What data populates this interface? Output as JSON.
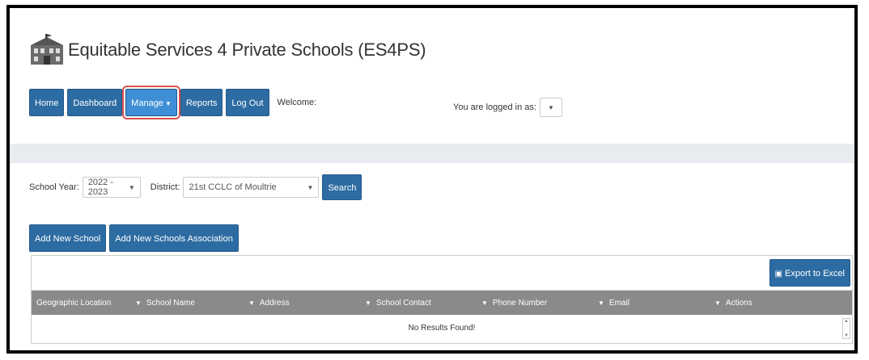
{
  "app": {
    "title": "Equitable Services 4 Private Schools (ES4PS)"
  },
  "nav": {
    "items": [
      "Home",
      "Dashboard",
      "Manage",
      "Reports",
      "Log Out"
    ],
    "welcome": "Welcome:",
    "logged_in_label": "You are logged in as:"
  },
  "filters": {
    "school_year_label": "School Year:",
    "school_year_value": "2022 - 2023",
    "district_label": "District:",
    "district_value": "21st CCLC of Moultrie",
    "search_label": "Search"
  },
  "actions": {
    "add_school": "Add New School",
    "add_association": "Add New Schools Association"
  },
  "grid": {
    "export_label": "Export to Excel",
    "columns": [
      "Geographic Location",
      "School Name",
      "Address",
      "School Contact",
      "Phone Number",
      "Email",
      "Actions"
    ],
    "empty_message": "No Results Found!"
  },
  "colors": {
    "primary": "#2d6ca2",
    "active": "#3f8fd6",
    "highlight": "#d9534f",
    "header": "#8a8a8a"
  }
}
